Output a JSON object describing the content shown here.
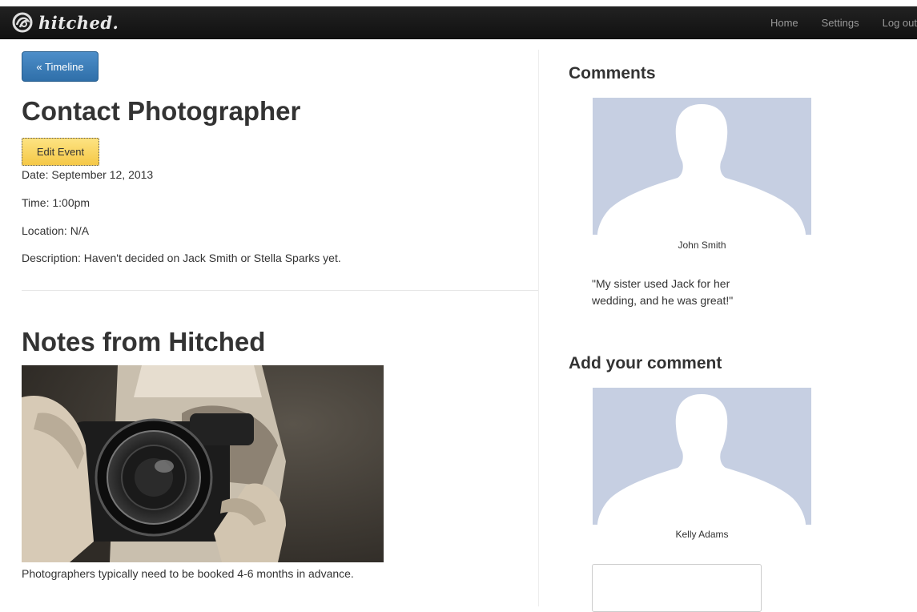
{
  "navbar": {
    "brand": "hitched.",
    "links": [
      "Home",
      "Settings",
      "Log out"
    ]
  },
  "event": {
    "back_label": "« Timeline",
    "title": "Contact Photographer",
    "edit_label": "Edit Event",
    "date": "Date: September 12, 2013",
    "time": "Time: 1:00pm",
    "location": "Location: N/A",
    "description": "Description: Haven't decided on Jack Smith or Stella Sparks yet."
  },
  "notes": {
    "title": "Notes from Hitched",
    "caption": "Photographers typically need to be booked 4-6 months in advance."
  },
  "comments": {
    "title": "Comments",
    "items": [
      {
        "author": "John Smith",
        "text": "\"My sister used Jack for her wedding, and he was great!\""
      }
    ]
  },
  "add_comment": {
    "title": "Add your comment",
    "author": "Kelly Adams",
    "value": ""
  },
  "colors": {
    "navbar": "#111111",
    "primary_button": "#3878b4",
    "warning_button": "#f8d05c",
    "avatar_bg": "#c6cfe2"
  }
}
